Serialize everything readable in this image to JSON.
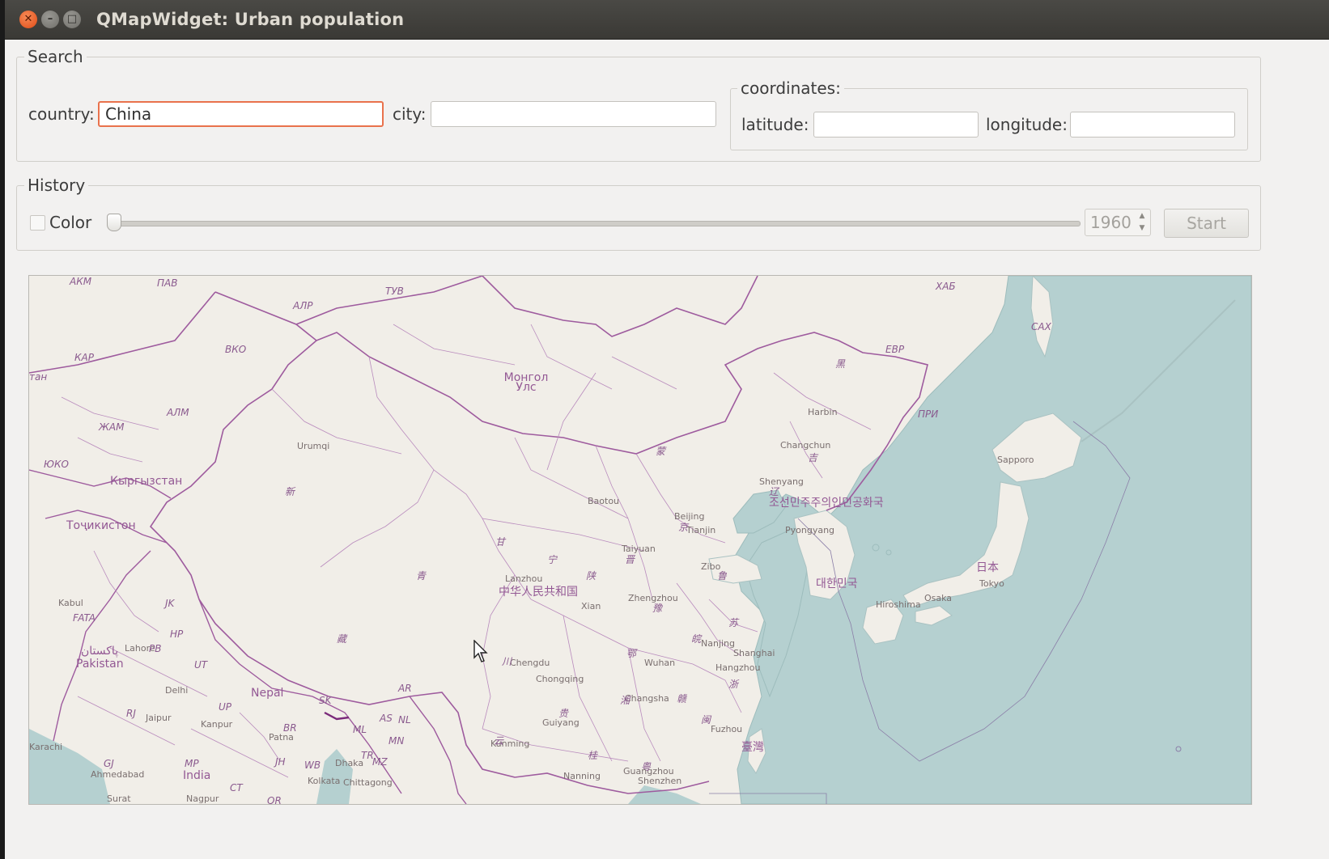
{
  "window": {
    "title": "QMapWidget: Urban population"
  },
  "search": {
    "group_title": "Search",
    "country_label": "country:",
    "country_value": "China",
    "city_label": "city:",
    "city_value": "",
    "coordinates": {
      "group_title": "coordinates:",
      "latitude_label": "latitude:",
      "latitude_value": "",
      "longitude_label": "longitude:",
      "longitude_value": ""
    }
  },
  "history": {
    "group_title": "History",
    "color_label": "Color",
    "color_checked": false,
    "year": "1960",
    "start_label": "Start"
  },
  "map": {
    "labels": [
      {
        "name": "map-label-akm",
        "text": "АКМ",
        "type": "region"
      },
      {
        "name": "map-label-pav",
        "text": "ПАВ",
        "type": "region"
      },
      {
        "name": "map-label-tuv",
        "text": "ТУВ",
        "type": "region"
      },
      {
        "name": "map-label-alr",
        "text": "АЛР",
        "type": "region"
      },
      {
        "name": "map-label-khab",
        "text": "ХАБ",
        "type": "region"
      },
      {
        "name": "map-label-sakh",
        "text": "САХ",
        "type": "region"
      },
      {
        "name": "map-label-kar",
        "text": "КАР",
        "type": "region"
      },
      {
        "name": "map-label-vko",
        "text": "ВКО",
        "type": "region"
      },
      {
        "name": "map-label-tan",
        "text": "тан",
        "type": "region"
      },
      {
        "name": "map-label-evr",
        "text": "ЕВР",
        "type": "region"
      },
      {
        "name": "map-label-mongolia",
        "text": "Монгол Улс",
        "type": "country"
      },
      {
        "name": "map-label-harbin",
        "text": "Harbin",
        "type": "city"
      },
      {
        "name": "map-label-pri",
        "text": "ПРИ",
        "type": "region"
      },
      {
        "name": "map-label-alm",
        "text": "АЛМ",
        "type": "region"
      },
      {
        "name": "map-label-zham",
        "text": "ЖАМ",
        "type": "region"
      },
      {
        "name": "map-label-urumqi",
        "text": "Urumqi",
        "type": "city"
      },
      {
        "name": "map-label-changchun",
        "text": "Changchun",
        "type": "city"
      },
      {
        "name": "map-label-sapporo",
        "text": "Sapporo",
        "type": "city"
      },
      {
        "name": "map-label-yuko",
        "text": "ЮКО",
        "type": "region"
      },
      {
        "name": "map-label-kyrgyzstan",
        "text": "Кыргызстан",
        "type": "country"
      },
      {
        "name": "map-label-shenyang",
        "text": "Shenyang",
        "type": "city"
      },
      {
        "name": "map-label-north-korea",
        "text": "조선민주주의인민공화국",
        "type": "country"
      },
      {
        "name": "map-label-baotou",
        "text": "Baotou",
        "type": "city"
      },
      {
        "name": "map-label-beijing",
        "text": "Beijing",
        "type": "city"
      },
      {
        "name": "map-label-tianjin",
        "text": "Tianjin",
        "type": "city"
      },
      {
        "name": "map-label-tajikistan",
        "text": "Тоҷикистон",
        "type": "country"
      },
      {
        "name": "map-label-pyongyang",
        "text": "Pyongyang",
        "type": "city"
      },
      {
        "name": "map-label-taiyuan",
        "text": "Taiyuan",
        "type": "city"
      },
      {
        "name": "map-label-zibo",
        "text": "Zibo",
        "type": "city"
      },
      {
        "name": "map-label-japan",
        "text": "日本",
        "type": "country"
      },
      {
        "name": "map-label-lanzhou",
        "text": "Lanzhou",
        "type": "city"
      },
      {
        "name": "map-label-china",
        "text": "中华人民共和国",
        "type": "country"
      },
      {
        "name": "map-label-south-korea",
        "text": "대한민국",
        "type": "country"
      },
      {
        "name": "map-label-tokyo",
        "text": "Tokyo",
        "type": "city"
      },
      {
        "name": "map-label-kabul",
        "text": "Kabul",
        "type": "city"
      },
      {
        "name": "map-label-jk",
        "text": "JK",
        "type": "region"
      },
      {
        "name": "map-label-xian",
        "text": "Xian",
        "type": "city"
      },
      {
        "name": "map-label-zhengzhou",
        "text": "Zhengzhou",
        "type": "city"
      },
      {
        "name": "map-label-hiroshima",
        "text": "Hiroshima",
        "type": "city"
      },
      {
        "name": "map-label-osaka",
        "text": "Osaka",
        "type": "city"
      },
      {
        "name": "map-label-fata",
        "text": "FATA",
        "type": "region"
      },
      {
        "name": "map-label-hp",
        "text": "HP",
        "type": "region"
      },
      {
        "name": "map-label-nanjing",
        "text": "Nanjing",
        "type": "city"
      },
      {
        "name": "map-label-shanghai",
        "text": "Shanghai",
        "type": "city"
      },
      {
        "name": "map-label-lahore",
        "text": "Lahore",
        "type": "city"
      },
      {
        "name": "map-label-pb",
        "text": "PB",
        "type": "region"
      },
      {
        "name": "map-label-ut",
        "text": "UT",
        "type": "region"
      },
      {
        "name": "map-label-wuhan",
        "text": "Wuhan",
        "type": "city"
      },
      {
        "name": "map-label-hangzhou",
        "text": "Hangzhou",
        "type": "city"
      },
      {
        "name": "map-label-pakistan-ur",
        "text": "پاکستان",
        "type": "country"
      },
      {
        "name": "map-label-pakistan",
        "text": "Pakistan",
        "type": "country"
      },
      {
        "name": "map-label-chengdu",
        "text": "Chengdu",
        "type": "city"
      },
      {
        "name": "map-label-delhi",
        "text": "Delhi",
        "type": "city"
      },
      {
        "name": "map-label-nepal",
        "text": "Nepal",
        "type": "country"
      },
      {
        "name": "map-label-ar",
        "text": "AR",
        "type": "region"
      },
      {
        "name": "map-label-chongqing",
        "text": "Chongqing",
        "type": "city"
      },
      {
        "name": "map-label-changsha",
        "text": "Changsha",
        "type": "city"
      },
      {
        "name": "map-label-sk",
        "text": "SK",
        "type": "region"
      },
      {
        "name": "map-label-rj",
        "text": "RJ",
        "type": "region"
      },
      {
        "name": "map-label-jaipur",
        "text": "Jaipur",
        "type": "city"
      },
      {
        "name": "map-label-up",
        "text": "UP",
        "type": "region"
      },
      {
        "name": "map-label-kanpur",
        "text": "Kanpur",
        "type": "city"
      },
      {
        "name": "map-label-as",
        "text": "AS",
        "type": "region"
      },
      {
        "name": "map-label-nl",
        "text": "NL",
        "type": "region"
      },
      {
        "name": "map-label-guiyang",
        "text": "Guiyang",
        "type": "city"
      },
      {
        "name": "map-label-fuzhou",
        "text": "Fuzhou",
        "type": "city"
      },
      {
        "name": "map-label-br",
        "text": "BR",
        "type": "region"
      },
      {
        "name": "map-label-patna",
        "text": "Patna",
        "type": "city"
      },
      {
        "name": "map-label-ml",
        "text": "ML",
        "type": "region"
      },
      {
        "name": "map-label-mn",
        "text": "MN",
        "type": "region"
      },
      {
        "name": "map-label-karachi",
        "text": "Karachi",
        "type": "city"
      },
      {
        "name": "map-label-kunming",
        "text": "Kunming",
        "type": "city"
      },
      {
        "name": "map-label-taiwan",
        "text": "臺灣",
        "type": "country"
      },
      {
        "name": "map-label-tr",
        "text": "TR",
        "type": "region"
      },
      {
        "name": "map-label-gj",
        "text": "GJ",
        "type": "region"
      },
      {
        "name": "map-label-mp",
        "text": "MP",
        "type": "region"
      },
      {
        "name": "map-label-jh",
        "text": "JH",
        "type": "region"
      },
      {
        "name": "map-label-wb",
        "text": "WB",
        "type": "region"
      },
      {
        "name": "map-label-dhaka",
        "text": "Dhaka",
        "type": "city"
      },
      {
        "name": "map-label-mz",
        "text": "MZ",
        "type": "region"
      },
      {
        "name": "map-label-ahmedabad",
        "text": "Ahmedabad",
        "type": "city"
      },
      {
        "name": "map-label-india",
        "text": "India",
        "type": "country"
      },
      {
        "name": "map-label-ct",
        "text": "CT",
        "type": "region"
      },
      {
        "name": "map-label-kolkata",
        "text": "Kolkata",
        "type": "city"
      },
      {
        "name": "map-label-chittagong",
        "text": "Chittagong",
        "type": "city"
      },
      {
        "name": "map-label-nanning",
        "text": "Nanning",
        "type": "city"
      },
      {
        "name": "map-label-guangzhou",
        "text": "Guangzhou",
        "type": "city"
      },
      {
        "name": "map-label-shenzhen",
        "text": "Shenzhen",
        "type": "city"
      },
      {
        "name": "map-label-surat",
        "text": "Surat",
        "type": "city"
      },
      {
        "name": "map-label-nagpur",
        "text": "Nagpur",
        "type": "city"
      },
      {
        "name": "map-label-or",
        "text": "OR",
        "type": "region"
      },
      {
        "name": "map-label-xin",
        "text": "新",
        "type": "region"
      },
      {
        "name": "map-label-qing",
        "text": "青",
        "type": "region"
      },
      {
        "name": "map-label-zang",
        "text": "藏",
        "type": "region"
      },
      {
        "name": "map-label-gan",
        "text": "甘",
        "type": "region"
      },
      {
        "name": "map-label-meng",
        "text": "蒙",
        "type": "region"
      },
      {
        "name": "map-label-hei",
        "text": "黑",
        "type": "region"
      },
      {
        "name": "map-label-ji",
        "text": "吉",
        "type": "region"
      },
      {
        "name": "map-label-liao",
        "text": "辽",
        "type": "region"
      },
      {
        "name": "map-label-jing",
        "text": "京",
        "type": "region"
      },
      {
        "name": "map-label-jin",
        "text": "晋",
        "type": "region"
      },
      {
        "name": "map-label-lu",
        "text": "鲁",
        "type": "region"
      },
      {
        "name": "map-label-ning",
        "text": "宁",
        "type": "region"
      },
      {
        "name": "map-label-shaan",
        "text": "陕",
        "type": "region"
      },
      {
        "name": "map-label-yu",
        "text": "豫",
        "type": "region"
      },
      {
        "name": "map-label-su",
        "text": "苏",
        "type": "region"
      },
      {
        "name": "map-label-wan",
        "text": "皖",
        "type": "region"
      },
      {
        "name": "map-label-e",
        "text": "鄂",
        "type": "region"
      },
      {
        "name": "map-label-chuan",
        "text": "川",
        "type": "region"
      },
      {
        "name": "map-label-zhe",
        "text": "浙",
        "type": "region"
      },
      {
        "name": "map-label-xiang",
        "text": "湘",
        "type": "region"
      },
      {
        "name": "map-label-gan2",
        "text": "赣",
        "type": "region"
      },
      {
        "name": "map-label-qian",
        "text": "贵",
        "type": "region"
      },
      {
        "name": "map-label-min",
        "text": "闽",
        "type": "region"
      },
      {
        "name": "map-label-dian",
        "text": "云",
        "type": "region"
      },
      {
        "name": "map-label-gui",
        "text": "桂",
        "type": "region"
      },
      {
        "name": "map-label-yue",
        "text": "粤",
        "type": "region"
      }
    ]
  },
  "colors": {
    "land": "#f1eee8",
    "water": "#b5d0d0",
    "border": "#9e5b9e",
    "focus": "#e9724c"
  }
}
